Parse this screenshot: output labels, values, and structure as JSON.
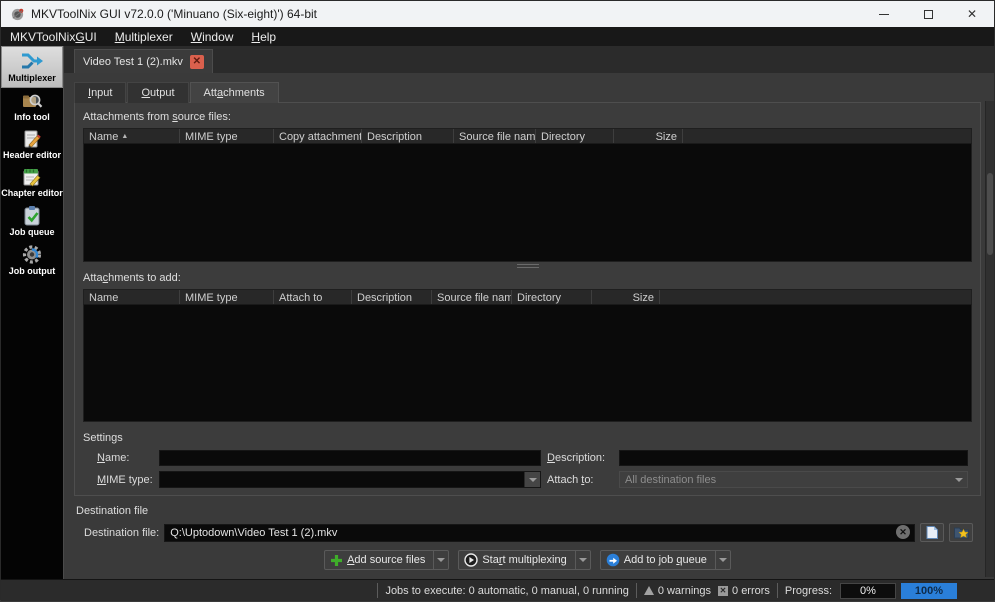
{
  "titlebar": {
    "title": "MKVToolNix GUI v72.0.0 ('Minuano (Six-eight)') 64-bit",
    "close_glyph": "✕"
  },
  "menubar": {
    "items": {
      "app": "MKVToolNix &GUI",
      "multiplexer": "&Multiplexer",
      "window": "&Window",
      "help": "&Help"
    }
  },
  "sidebar": {
    "items": [
      {
        "label": "Multiplexer",
        "icon": "multiplexer-icon",
        "selected": true
      },
      {
        "label": "Info tool",
        "icon": "info-tool-icon",
        "selected": false
      },
      {
        "label": "Header editor",
        "icon": "header-editor-icon",
        "selected": false
      },
      {
        "label": "Chapter editor",
        "icon": "chapter-editor-icon",
        "selected": false
      },
      {
        "label": "Job queue",
        "icon": "job-queue-icon",
        "selected": false
      },
      {
        "label": "Job output",
        "icon": "job-output-icon",
        "selected": false
      }
    ]
  },
  "filetab": {
    "label": "Video Test 1 (2).mkv",
    "close_glyph": "✕"
  },
  "subtabs": {
    "input": "&Input",
    "output": "&Output",
    "attachments": "Att&achments"
  },
  "from_section": {
    "label": "Attachments from &source files:",
    "sort_indicator": "▲",
    "columns": [
      "Name",
      "MIME type",
      "Copy attachment",
      "Description",
      "Source file name",
      "Directory",
      "Size"
    ],
    "rows": []
  },
  "add_section": {
    "label": "Atta&chments to add:",
    "columns": [
      "Name",
      "MIME type",
      "Attach to",
      "Description",
      "Source file name",
      "Directory",
      "Size"
    ],
    "rows": []
  },
  "settings": {
    "title": "Settings",
    "name_label": "&Name:",
    "name_value": "",
    "mime_label": "&MIME type:",
    "mime_value": "",
    "description_label": "&Description:",
    "description_value": "",
    "attach_label": "Attach &to:",
    "attach_value": "All destination files"
  },
  "destination": {
    "title": "Destination file",
    "label": "Destination file:",
    "value": "Q:\\Uptodown\\Video Test 1 (2).mkv",
    "clear_glyph": "✕"
  },
  "actions": {
    "add_source_files": "&Add source files",
    "start_multiplexing": "Sta&rt multiplexing",
    "add_to_job_queue": "Add to job &queue"
  },
  "statusbar": {
    "jobs": "Jobs to execute: 0 automatic, 0 manual, 0 running",
    "warnings": "0 warnings",
    "errors": "0 errors",
    "error_glyph": "✕",
    "progress_label": "Progress:",
    "progress_current": "0%",
    "progress_total": "100%"
  },
  "colors": {
    "accent_blue": "#2a7fd9",
    "tab_close_red": "#da604d",
    "plus_green": "#3fae2a",
    "titlebar_bg": "#f1f3f5",
    "content_bg": "#3a3a3a",
    "table_bg": "#0a0a0a"
  }
}
